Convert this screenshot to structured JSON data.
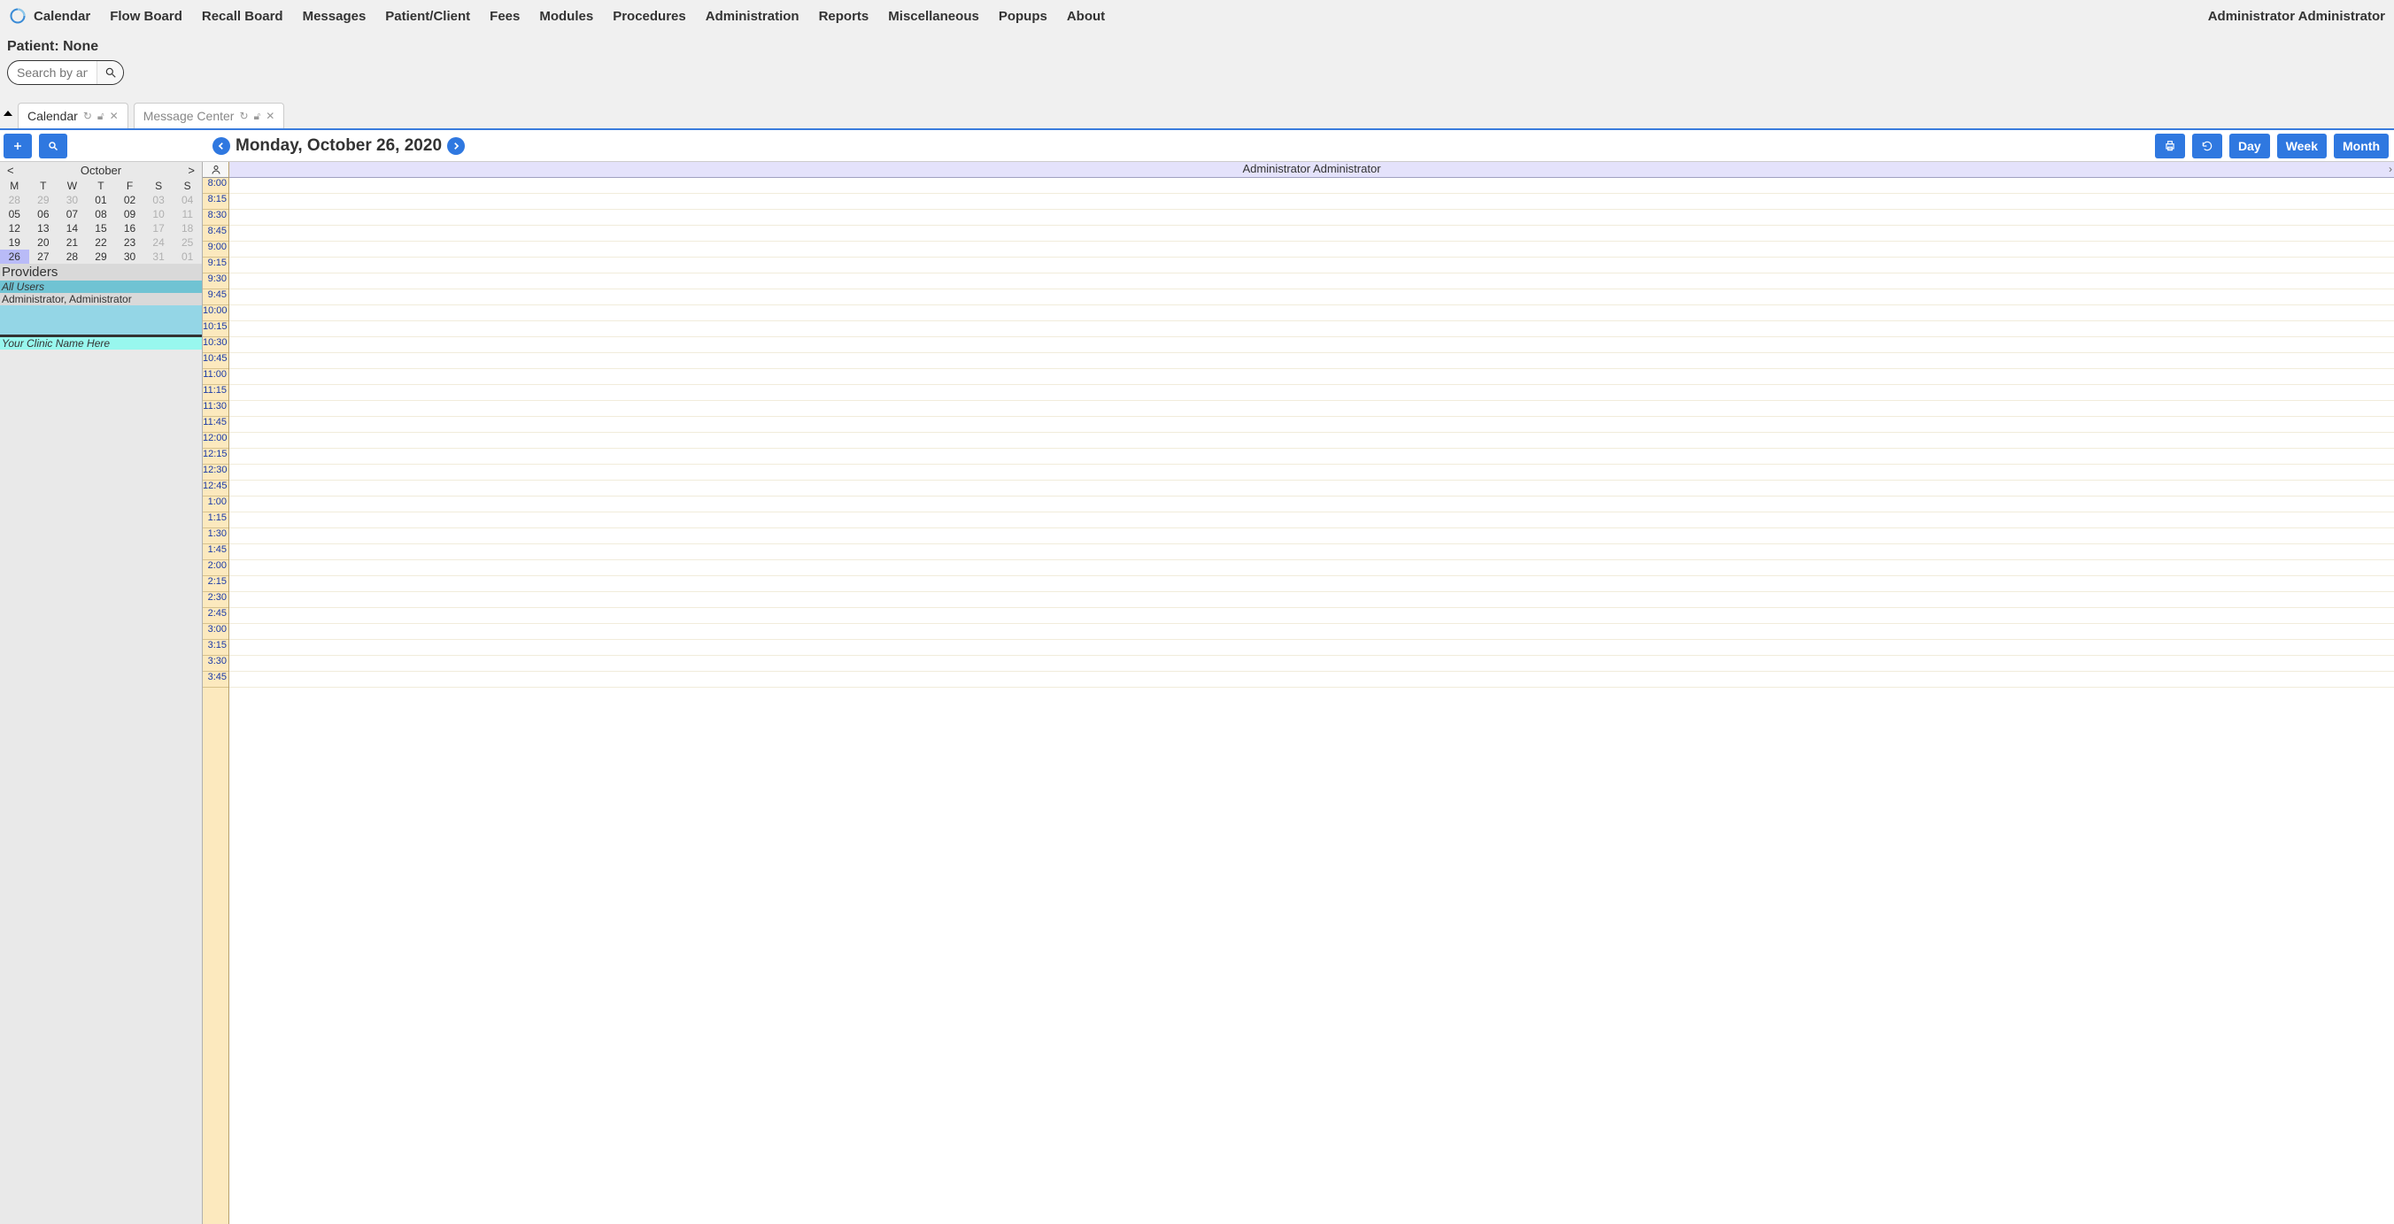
{
  "top_menu": {
    "items": [
      "Calendar",
      "Flow Board",
      "Recall Board",
      "Messages",
      "Patient/Client",
      "Fees",
      "Modules",
      "Procedures",
      "Administration",
      "Reports",
      "Miscellaneous",
      "Popups",
      "About"
    ],
    "user_name": "Administrator Administrator"
  },
  "patient": {
    "label": "Patient:",
    "value": "None",
    "search_placeholder": "Search by any de"
  },
  "tabs": {
    "items": [
      {
        "label": "Calendar",
        "active": true
      },
      {
        "label": "Message Center",
        "active": false
      }
    ]
  },
  "calendar_toolbar": {
    "date_title": "Monday, October 26, 2020",
    "views": {
      "day": "Day",
      "week": "Week",
      "month": "Month"
    }
  },
  "mini_calendar": {
    "month_label": "October",
    "prev": "<",
    "next": ">",
    "dow": [
      "M",
      "T",
      "W",
      "T",
      "F",
      "S",
      "S"
    ],
    "weeks": [
      [
        {
          "d": "28",
          "other": true
        },
        {
          "d": "29",
          "other": true
        },
        {
          "d": "30",
          "other": true
        },
        {
          "d": "01"
        },
        {
          "d": "02"
        },
        {
          "d": "03",
          "other": true
        },
        {
          "d": "04",
          "other": true
        }
      ],
      [
        {
          "d": "05"
        },
        {
          "d": "06"
        },
        {
          "d": "07"
        },
        {
          "d": "08"
        },
        {
          "d": "09"
        },
        {
          "d": "10",
          "other": true
        },
        {
          "d": "11",
          "other": true
        }
      ],
      [
        {
          "d": "12"
        },
        {
          "d": "13"
        },
        {
          "d": "14"
        },
        {
          "d": "15"
        },
        {
          "d": "16"
        },
        {
          "d": "17",
          "other": true
        },
        {
          "d": "18",
          "other": true
        }
      ],
      [
        {
          "d": "19"
        },
        {
          "d": "20"
        },
        {
          "d": "21"
        },
        {
          "d": "22"
        },
        {
          "d": "23"
        },
        {
          "d": "24",
          "other": true
        },
        {
          "d": "25",
          "other": true
        }
      ],
      [
        {
          "d": "26",
          "today": true
        },
        {
          "d": "27"
        },
        {
          "d": "28"
        },
        {
          "d": "29"
        },
        {
          "d": "30"
        },
        {
          "d": "31",
          "other": true
        },
        {
          "d": "01",
          "other": true
        }
      ]
    ]
  },
  "providers": {
    "title": "Providers",
    "all_label": "All Users",
    "admin_label": "Administrator, Administrator",
    "clinic_label": "Your Clinic Name Here"
  },
  "schedule": {
    "header_provider": "Administrator Administrator",
    "time_slots": [
      "8:00",
      "8:15",
      "8:30",
      "8:45",
      "9:00",
      "9:15",
      "9:30",
      "9:45",
      "10:00",
      "10:15",
      "10:30",
      "10:45",
      "11:00",
      "11:15",
      "11:30",
      "11:45",
      "12:00",
      "12:15",
      "12:30",
      "12:45",
      "1:00",
      "1:15",
      "1:30",
      "1:45",
      "2:00",
      "2:15",
      "2:30",
      "2:45",
      "3:00",
      "3:15",
      "3:30",
      "3:45"
    ]
  }
}
